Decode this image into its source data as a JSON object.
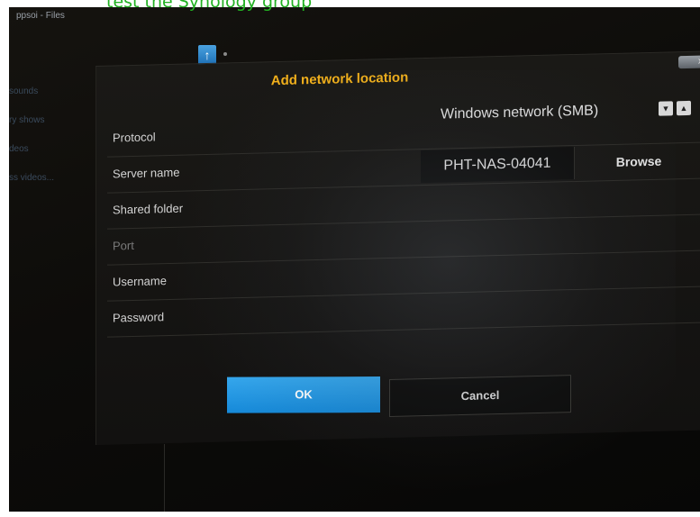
{
  "caption": "test the Synology group",
  "background": {
    "window_title": "ppsoi - Files",
    "sidebar_items": [
      "sounds",
      "ry shows",
      "deos",
      "ss videos..."
    ]
  },
  "dialog": {
    "title": "Add network location",
    "close_glyph": "x",
    "fields": {
      "protocol": {
        "label": "Protocol",
        "value": "Windows network (SMB)"
      },
      "server_name": {
        "label": "Server name",
        "value": "PHT-NAS-04041",
        "browse_label": "Browse"
      },
      "shared_folder": {
        "label": "Shared folder",
        "value": ""
      },
      "port": {
        "label": "Port",
        "value": ""
      },
      "username": {
        "label": "Username",
        "value": ""
      },
      "password": {
        "label": "Password",
        "value": ""
      }
    },
    "ok_label": "OK",
    "cancel_label": "Cancel"
  },
  "icons": {
    "protocol_down": "chevron-down-icon",
    "protocol_up": "chevron-up-icon",
    "parent_folder": "arrow-up-icon"
  },
  "colors": {
    "title_accent": "#f3b11b",
    "ok_button": "#1f95e2",
    "caption": "#22b022"
  }
}
